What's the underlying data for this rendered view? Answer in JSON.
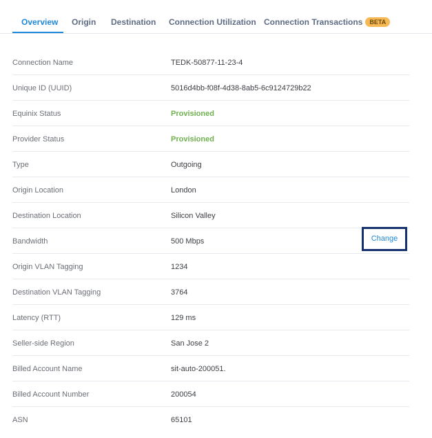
{
  "tabs": {
    "overview": "Overview",
    "origin": "Origin",
    "destination": "Destination",
    "utilization": "Connection Utilization",
    "transactions": "Connection Transactions",
    "beta_badge": "BETA",
    "active": "Overview"
  },
  "colors": {
    "accent": "#1f88d8",
    "status_ok": "#6fb04f",
    "badge": "#f7b955",
    "highlight_border": "#12316e"
  },
  "details": {
    "rows": [
      {
        "label": "Connection Name",
        "value": "TEDK-50877-11-23-4"
      },
      {
        "label": "Unique ID (UUID)",
        "value": "5016d4bb-f08f-4d38-8ab5-6c9124729b22"
      },
      {
        "label": "Equinix Status",
        "value": "Provisioned"
      },
      {
        "label": "Provider Status",
        "value": "Provisioned"
      },
      {
        "label": "Type",
        "value": "Outgoing"
      },
      {
        "label": "Origin Location",
        "value": "London"
      },
      {
        "label": "Destination Location",
        "value": "Silicon Valley"
      },
      {
        "label": "Bandwidth",
        "value": "500 Mbps"
      },
      {
        "label": "Origin VLAN Tagging",
        "value": "1234"
      },
      {
        "label": "Destination VLAN Tagging",
        "value": "3764"
      },
      {
        "label": "Latency (RTT)",
        "value": "129 ms"
      },
      {
        "label": "Seller-side Region",
        "value": "San Jose 2"
      },
      {
        "label": "Billed Account Name",
        "value": "sit-auto-200051."
      },
      {
        "label": "Billed Account Number",
        "value": "200054"
      },
      {
        "label": "ASN",
        "value": "65101"
      }
    ],
    "change_label": "Change"
  }
}
